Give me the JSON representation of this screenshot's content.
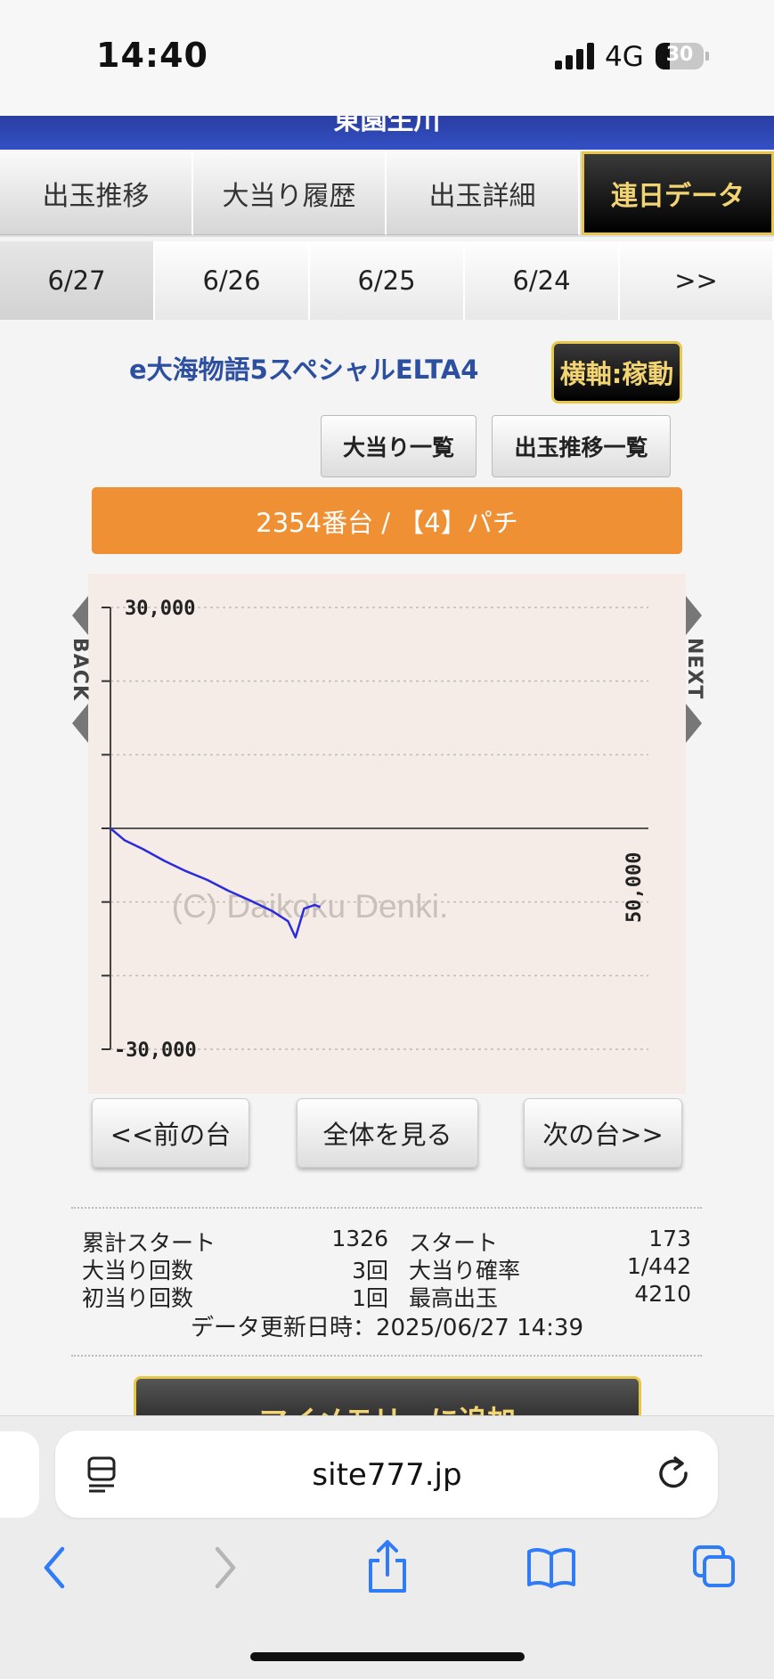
{
  "status_bar": {
    "time": "14:40",
    "network": "4G",
    "battery": "30",
    "battery_level": 0.3
  },
  "site_header": {
    "title": "東園生川"
  },
  "tabs": [
    {
      "label": "出玉推移",
      "active": false
    },
    {
      "label": "大当り履歴",
      "active": false
    },
    {
      "label": "出玉詳細",
      "active": false
    },
    {
      "label": "連日データ",
      "active": true
    }
  ],
  "dates": [
    {
      "label": "6/27",
      "active": true
    },
    {
      "label": "6/26",
      "active": false
    },
    {
      "label": "6/25",
      "active": false
    },
    {
      "label": "6/24",
      "active": false
    },
    {
      "label": ">>",
      "active": false
    }
  ],
  "machine": {
    "name": "e大海物語5スペシャルELTA4",
    "axis_button": "横軸:稼動",
    "jackpot_list_button": "大当り一覧",
    "payout_list_button": "出玉推移一覧",
    "banner": "2354番台 / 【4】パチ"
  },
  "chart": {
    "back_label": "BACK",
    "next_label": "NEXT",
    "watermark": "(C) Daikoku Denki.",
    "x_end_label": "50,000"
  },
  "chart_data": {
    "type": "line",
    "title": "",
    "xlabel": "",
    "ylabel": "",
    "ylim": [
      -30000,
      30000
    ],
    "xlim": [
      0,
      50000
    ],
    "y_ticks": [
      30000,
      20000,
      10000,
      0,
      -10000,
      -20000,
      -30000
    ],
    "y_tick_labels": [
      "30,000",
      "",
      "",
      "",
      "",
      "",
      "-30,000"
    ],
    "grid": true,
    "series": [
      {
        "color": "#2b2bdc",
        "x": [
          0,
          1300,
          3000,
          5000,
          7000,
          9000,
          11000,
          13000,
          15000,
          16500,
          17200,
          18000,
          19000,
          19500
        ],
        "y": [
          0,
          -1600,
          -2800,
          -4400,
          -5800,
          -7000,
          -8500,
          -9800,
          -11200,
          -12600,
          -14800,
          -10900,
          -10400,
          -10700
        ]
      }
    ]
  },
  "nav_buttons": {
    "prev": "<<前の台",
    "all": "全体を見る",
    "next": "次の台>>"
  },
  "stats": {
    "cumulative_start_label": "累計スタート",
    "cumulative_start_value": "1326",
    "start_label": "スタート",
    "start_value": "173",
    "jackpot_count_label": "大当り回数",
    "jackpot_count_value": "3回",
    "jackpot_prob_label": "大当り確率",
    "jackpot_prob_value": "1/442",
    "first_hit_label": "初当り回数",
    "first_hit_value": "1回",
    "max_payout_label": "最高出玉",
    "max_payout_value": "4210",
    "updated": "データ更新日時：2025/06/27 14:39"
  },
  "mymemory": {
    "label": "マイメモリーに追加"
  },
  "browser": {
    "url": "site777.jp"
  }
}
